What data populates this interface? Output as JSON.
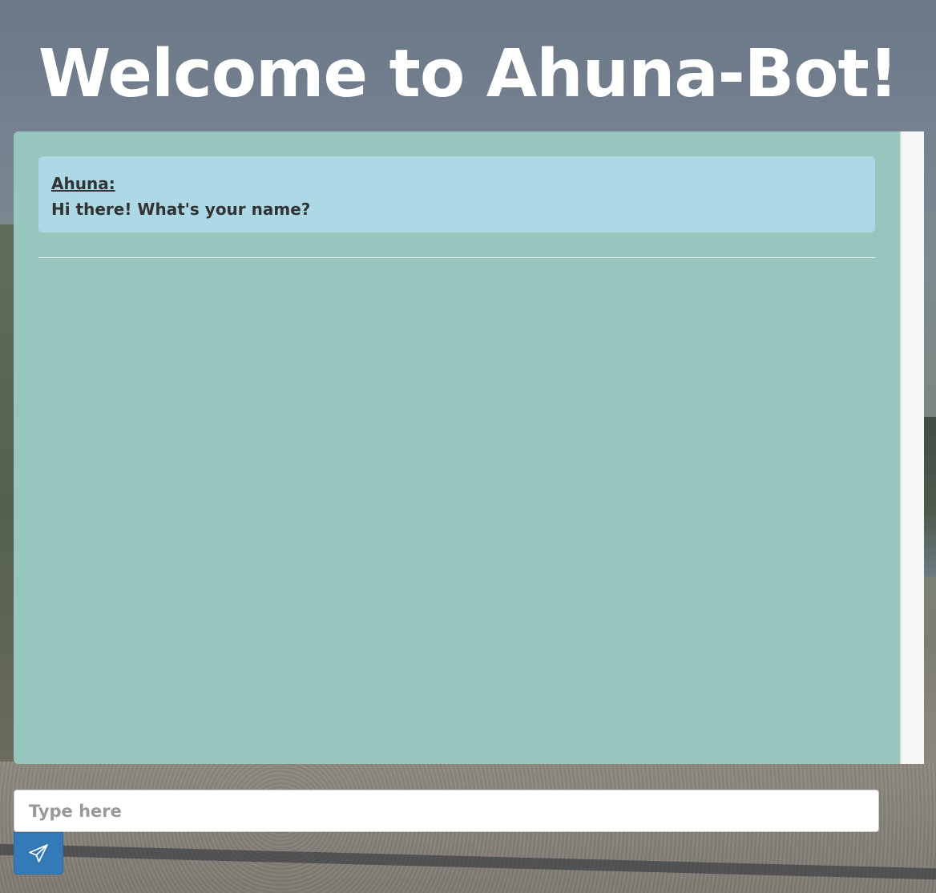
{
  "header": {
    "title": "Welcome to Ahuna-Bot!"
  },
  "chat": {
    "messages": [
      {
        "sender": "Ahuna:",
        "text": "Hi there! What's your name?"
      }
    ]
  },
  "composer": {
    "placeholder": "Type here",
    "value": "",
    "send_icon": "paper-plane-icon"
  },
  "colors": {
    "panel": "#96c6be",
    "bubble": "#add8e6",
    "button": "#337ab7",
    "title": "#ffffff"
  }
}
